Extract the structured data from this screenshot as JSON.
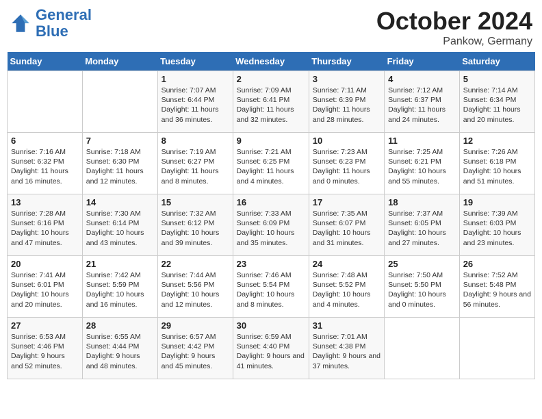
{
  "header": {
    "logo_line1": "General",
    "logo_line2": "Blue",
    "month": "October 2024",
    "location": "Pankow, Germany"
  },
  "weekdays": [
    "Sunday",
    "Monday",
    "Tuesday",
    "Wednesday",
    "Thursday",
    "Friday",
    "Saturday"
  ],
  "weeks": [
    [
      {
        "day": "",
        "info": ""
      },
      {
        "day": "",
        "info": ""
      },
      {
        "day": "1",
        "info": "Sunrise: 7:07 AM\nSunset: 6:44 PM\nDaylight: 11 hours and 36 minutes."
      },
      {
        "day": "2",
        "info": "Sunrise: 7:09 AM\nSunset: 6:41 PM\nDaylight: 11 hours and 32 minutes."
      },
      {
        "day": "3",
        "info": "Sunrise: 7:11 AM\nSunset: 6:39 PM\nDaylight: 11 hours and 28 minutes."
      },
      {
        "day": "4",
        "info": "Sunrise: 7:12 AM\nSunset: 6:37 PM\nDaylight: 11 hours and 24 minutes."
      },
      {
        "day": "5",
        "info": "Sunrise: 7:14 AM\nSunset: 6:34 PM\nDaylight: 11 hours and 20 minutes."
      }
    ],
    [
      {
        "day": "6",
        "info": "Sunrise: 7:16 AM\nSunset: 6:32 PM\nDaylight: 11 hours and 16 minutes."
      },
      {
        "day": "7",
        "info": "Sunrise: 7:18 AM\nSunset: 6:30 PM\nDaylight: 11 hours and 12 minutes."
      },
      {
        "day": "8",
        "info": "Sunrise: 7:19 AM\nSunset: 6:27 PM\nDaylight: 11 hours and 8 minutes."
      },
      {
        "day": "9",
        "info": "Sunrise: 7:21 AM\nSunset: 6:25 PM\nDaylight: 11 hours and 4 minutes."
      },
      {
        "day": "10",
        "info": "Sunrise: 7:23 AM\nSunset: 6:23 PM\nDaylight: 11 hours and 0 minutes."
      },
      {
        "day": "11",
        "info": "Sunrise: 7:25 AM\nSunset: 6:21 PM\nDaylight: 10 hours and 55 minutes."
      },
      {
        "day": "12",
        "info": "Sunrise: 7:26 AM\nSunset: 6:18 PM\nDaylight: 10 hours and 51 minutes."
      }
    ],
    [
      {
        "day": "13",
        "info": "Sunrise: 7:28 AM\nSunset: 6:16 PM\nDaylight: 10 hours and 47 minutes."
      },
      {
        "day": "14",
        "info": "Sunrise: 7:30 AM\nSunset: 6:14 PM\nDaylight: 10 hours and 43 minutes."
      },
      {
        "day": "15",
        "info": "Sunrise: 7:32 AM\nSunset: 6:12 PM\nDaylight: 10 hours and 39 minutes."
      },
      {
        "day": "16",
        "info": "Sunrise: 7:33 AM\nSunset: 6:09 PM\nDaylight: 10 hours and 35 minutes."
      },
      {
        "day": "17",
        "info": "Sunrise: 7:35 AM\nSunset: 6:07 PM\nDaylight: 10 hours and 31 minutes."
      },
      {
        "day": "18",
        "info": "Sunrise: 7:37 AM\nSunset: 6:05 PM\nDaylight: 10 hours and 27 minutes."
      },
      {
        "day": "19",
        "info": "Sunrise: 7:39 AM\nSunset: 6:03 PM\nDaylight: 10 hours and 23 minutes."
      }
    ],
    [
      {
        "day": "20",
        "info": "Sunrise: 7:41 AM\nSunset: 6:01 PM\nDaylight: 10 hours and 20 minutes."
      },
      {
        "day": "21",
        "info": "Sunrise: 7:42 AM\nSunset: 5:59 PM\nDaylight: 10 hours and 16 minutes."
      },
      {
        "day": "22",
        "info": "Sunrise: 7:44 AM\nSunset: 5:56 PM\nDaylight: 10 hours and 12 minutes."
      },
      {
        "day": "23",
        "info": "Sunrise: 7:46 AM\nSunset: 5:54 PM\nDaylight: 10 hours and 8 minutes."
      },
      {
        "day": "24",
        "info": "Sunrise: 7:48 AM\nSunset: 5:52 PM\nDaylight: 10 hours and 4 minutes."
      },
      {
        "day": "25",
        "info": "Sunrise: 7:50 AM\nSunset: 5:50 PM\nDaylight: 10 hours and 0 minutes."
      },
      {
        "day": "26",
        "info": "Sunrise: 7:52 AM\nSunset: 5:48 PM\nDaylight: 9 hours and 56 minutes."
      }
    ],
    [
      {
        "day": "27",
        "info": "Sunrise: 6:53 AM\nSunset: 4:46 PM\nDaylight: 9 hours and 52 minutes."
      },
      {
        "day": "28",
        "info": "Sunrise: 6:55 AM\nSunset: 4:44 PM\nDaylight: 9 hours and 48 minutes."
      },
      {
        "day": "29",
        "info": "Sunrise: 6:57 AM\nSunset: 4:42 PM\nDaylight: 9 hours and 45 minutes."
      },
      {
        "day": "30",
        "info": "Sunrise: 6:59 AM\nSunset: 4:40 PM\nDaylight: 9 hours and 41 minutes."
      },
      {
        "day": "31",
        "info": "Sunrise: 7:01 AM\nSunset: 4:38 PM\nDaylight: 9 hours and 37 minutes."
      },
      {
        "day": "",
        "info": ""
      },
      {
        "day": "",
        "info": ""
      }
    ]
  ]
}
